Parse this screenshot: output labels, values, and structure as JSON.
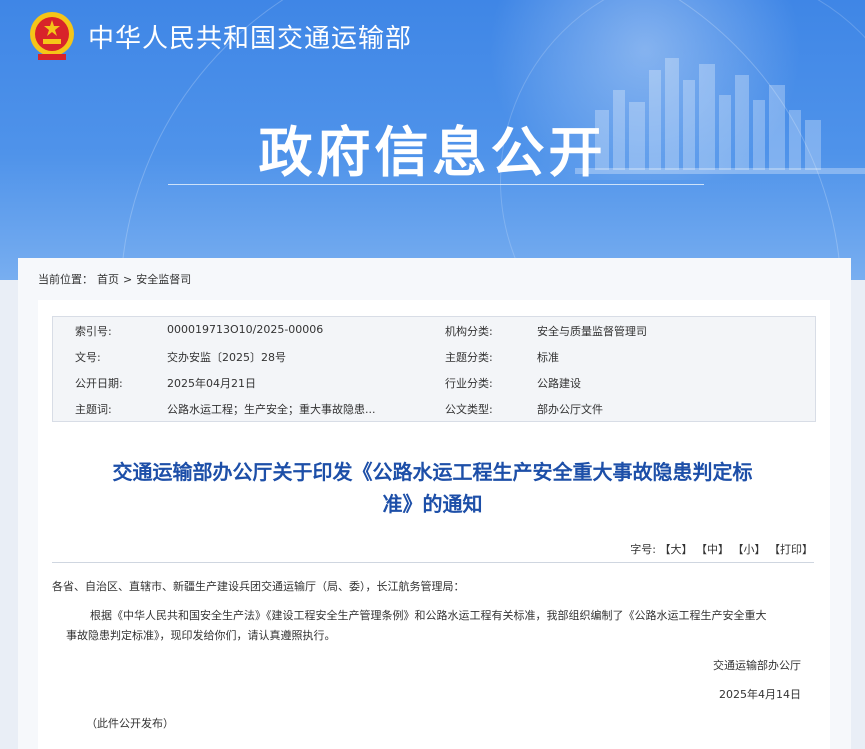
{
  "header": {
    "site_name": "中华人民共和国交通运输部",
    "banner_title": "政府信息公开"
  },
  "breadcrumb": {
    "label": "当前位置：",
    "home": "首页",
    "separator": ">",
    "current": "安全监督司"
  },
  "meta": {
    "index_label": "索引号:",
    "index_value": "000019713O10/2025-00006",
    "org_label": "机构分类:",
    "org_value": "安全与质量监督管理司",
    "doc_no_label": "文号:",
    "doc_no_value": "交办安监〔2025〕28号",
    "topic_label": "主题分类:",
    "topic_value": "标准",
    "date_label": "公开日期:",
    "date_value": "2025年04月21日",
    "industry_label": "行业分类:",
    "industry_value": "公路建设",
    "keywords_label": "主题词:",
    "keywords_value": "公路水运工程；生产安全；重大事故隐患...",
    "type_label": "公文类型:",
    "type_value": "部办公厅文件"
  },
  "document": {
    "title_line1": "交通运输部办公厅关于印发《公路水运工程生产安全重大事故隐患判定标",
    "title_line2": "准》的通知",
    "font_size_label": "字号:",
    "font_large": "【大】",
    "font_medium": "【中】",
    "font_small": "【小】",
    "print": "【打印】",
    "recipients": "各省、自治区、直辖市、新疆生产建设兵团交通运输厅（局、委），长江航务管理局：",
    "body_line1": "根据《中华人民共和国安全生产法》《建设工程安全生产管理条例》和公路水运工程有关标准，我部组织编制了《公路水运工程生产安全重大",
    "body_line2": "事故隐患判定标准》，现印发给你们，请认真遵照执行。",
    "signer": "交通运输部办公厅",
    "sign_date": "2025年4月14日",
    "note": "（此件公开发布）"
  },
  "colors": {
    "hero_blue": "#3f86e6",
    "title_blue": "#1d4fa8",
    "emblem_red": "#d8232a",
    "emblem_gold": "#f5c518"
  }
}
